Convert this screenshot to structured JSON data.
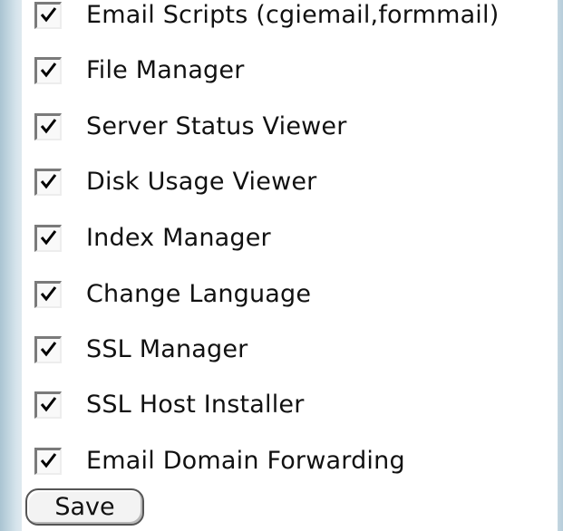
{
  "options": [
    {
      "label": "Email Scripts (cgiemail,formmail)",
      "checked": true
    },
    {
      "label": "File Manager",
      "checked": true
    },
    {
      "label": "Server Status Viewer",
      "checked": true
    },
    {
      "label": "Disk Usage Viewer",
      "checked": true
    },
    {
      "label": "Index Manager",
      "checked": true
    },
    {
      "label": "Change Language",
      "checked": true
    },
    {
      "label": "SSL Manager",
      "checked": true
    },
    {
      "label": "SSL Host Installer",
      "checked": true
    },
    {
      "label": "Email Domain Forwarding",
      "checked": true
    }
  ],
  "form": {
    "save_label": "Save"
  }
}
